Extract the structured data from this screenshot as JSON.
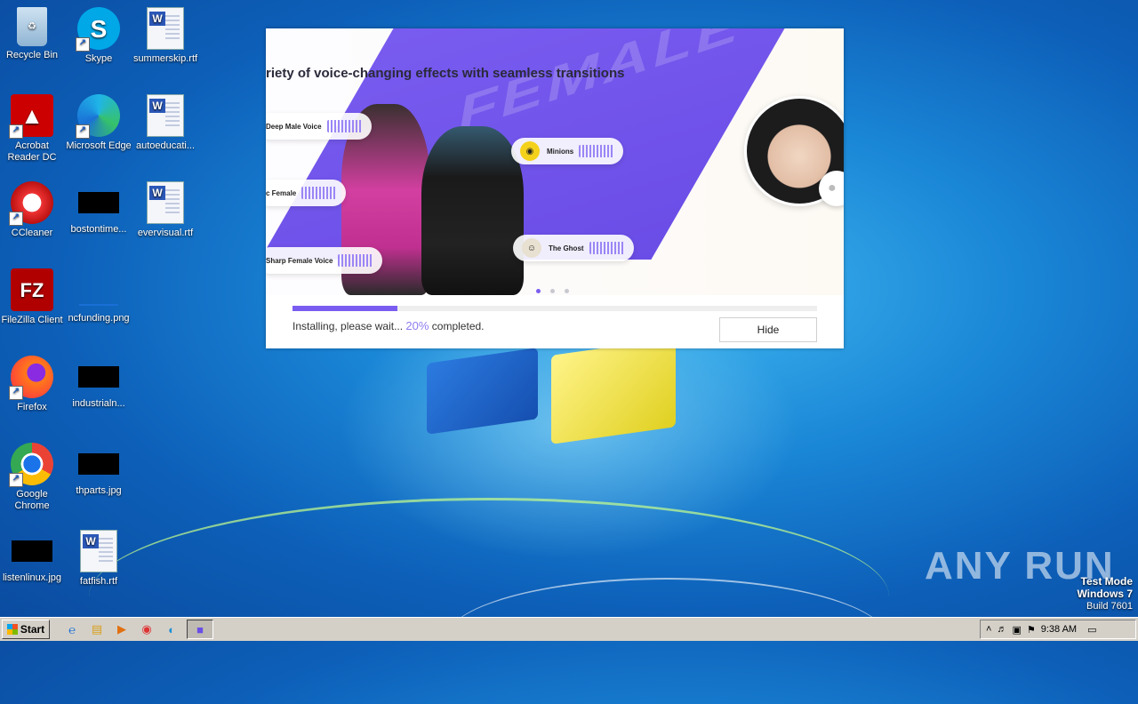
{
  "desktop": {
    "icons": [
      {
        "label": "Recycle Bin"
      },
      {
        "label": "Skype"
      },
      {
        "label": "summerskip.rtf"
      },
      {
        "label": "Acrobat Reader DC"
      },
      {
        "label": "Microsoft Edge"
      },
      {
        "label": "autoeducati..."
      },
      {
        "label": "CCleaner"
      },
      {
        "label": "bostontime..."
      },
      {
        "label": "evervisual.rtf"
      },
      {
        "label": "FileZilla Client"
      },
      {
        "label": "ncfunding.png"
      },
      {
        "label": "Firefox"
      },
      {
        "label": "industrialn..."
      },
      {
        "label": "Google Chrome"
      },
      {
        "label": "thparts.jpg"
      },
      {
        "label": "listenlinux.jpg"
      },
      {
        "label": "fatfish.rtf"
      }
    ]
  },
  "installer": {
    "banner_title": "riety of voice-changing effects with seamless transitions",
    "watermark": "FEMALE",
    "voices": [
      {
        "label": "Deep Male Voice"
      },
      {
        "label": "c Female"
      },
      {
        "label": "Sharp Female Voice"
      },
      {
        "label": "Minions"
      },
      {
        "label": "The Ghost"
      }
    ],
    "progress_fraction": 0.2,
    "status_prefix": "Installing, please wait...",
    "status_percent": "20%",
    "status_suffix": "completed.",
    "hide_label": "Hide"
  },
  "watermark": {
    "brand": "ANY RUN",
    "line1": "Test Mode",
    "line2": "Windows 7",
    "line3": "Build 7601"
  },
  "taskbar": {
    "start_label": "Start",
    "clock": "9:38 AM"
  }
}
